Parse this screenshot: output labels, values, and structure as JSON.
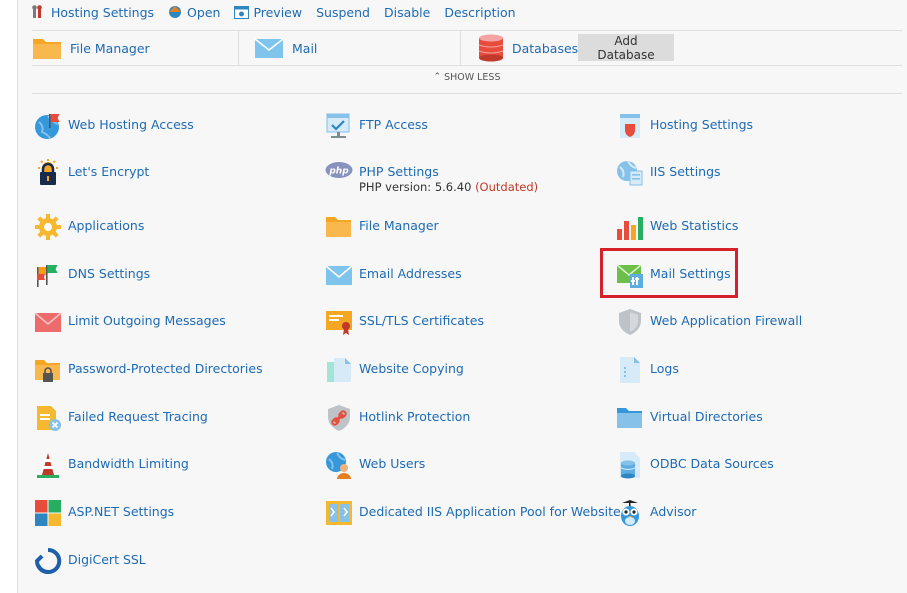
{
  "actions": [
    {
      "icon": "hosting-settings-icon",
      "label": "Hosting Settings"
    },
    {
      "icon": "open-icon",
      "label": "Open"
    },
    {
      "icon": "preview-icon",
      "label": "Preview"
    },
    {
      "icon": "",
      "label": "Suspend"
    },
    {
      "icon": "",
      "label": "Disable"
    },
    {
      "icon": "",
      "label": "Description"
    }
  ],
  "services": {
    "file_manager": "File Manager",
    "mail": "Mail",
    "databases": "Databases",
    "add_database": "Add Database"
  },
  "show_less": "SHOW LESS",
  "tools": {
    "col1": [
      {
        "icon": "globe-flag-icon",
        "label": "Web Hosting Access"
      },
      {
        "icon": "lock-sun-icon",
        "label": "Let's Encrypt"
      },
      {
        "icon": "gear-icon",
        "label": "Applications"
      },
      {
        "icon": "dns-flags-icon",
        "label": "DNS Settings"
      },
      {
        "icon": "envelope-red-icon",
        "label": "Limit Outgoing Messages"
      },
      {
        "icon": "folder-lock-icon",
        "label": "Password-Protected Directories"
      },
      {
        "icon": "failed-request-icon",
        "label": "Failed Request Tracing"
      },
      {
        "icon": "bandwidth-icon",
        "label": "Bandwidth Limiting"
      },
      {
        "icon": "aspnet-icon",
        "label": "ASP.NET Settings"
      },
      {
        "icon": "digicert-icon",
        "label": "DigiCert SSL"
      }
    ],
    "col2": [
      {
        "icon": "ftp-icon",
        "label": "FTP Access"
      },
      {
        "icon": "php-icon",
        "label": "PHP Settings",
        "sub": "PHP version: 5.6.40",
        "sub_warn": "(Outdated)"
      },
      {
        "icon": "folder-icon",
        "label": "File Manager"
      },
      {
        "icon": "envelope-icon",
        "label": "Email Addresses"
      },
      {
        "icon": "certificate-icon",
        "label": "SSL/TLS Certificates"
      },
      {
        "icon": "copy-icon",
        "label": "Website Copying"
      },
      {
        "icon": "hotlink-icon",
        "label": "Hotlink Protection"
      },
      {
        "icon": "web-users-icon",
        "label": "Web Users"
      },
      {
        "icon": "app-pool-icon",
        "label": "Dedicated IIS Application Pool for Website"
      }
    ],
    "col3": [
      {
        "icon": "hosting-doc-icon",
        "label": "Hosting Settings"
      },
      {
        "icon": "iis-icon",
        "label": "IIS Settings"
      },
      {
        "icon": "stats-icon",
        "label": "Web Statistics"
      },
      {
        "icon": "mail-settings-icon",
        "label": "Mail Settings"
      },
      {
        "icon": "shield-icon",
        "label": "Web Application Firewall"
      },
      {
        "icon": "logs-icon",
        "label": "Logs"
      },
      {
        "icon": "virtual-dir-icon",
        "label": "Virtual Directories"
      },
      {
        "icon": "odbc-icon",
        "label": "ODBC Data Sources"
      },
      {
        "icon": "advisor-owl-icon",
        "label": "Advisor"
      }
    ]
  }
}
